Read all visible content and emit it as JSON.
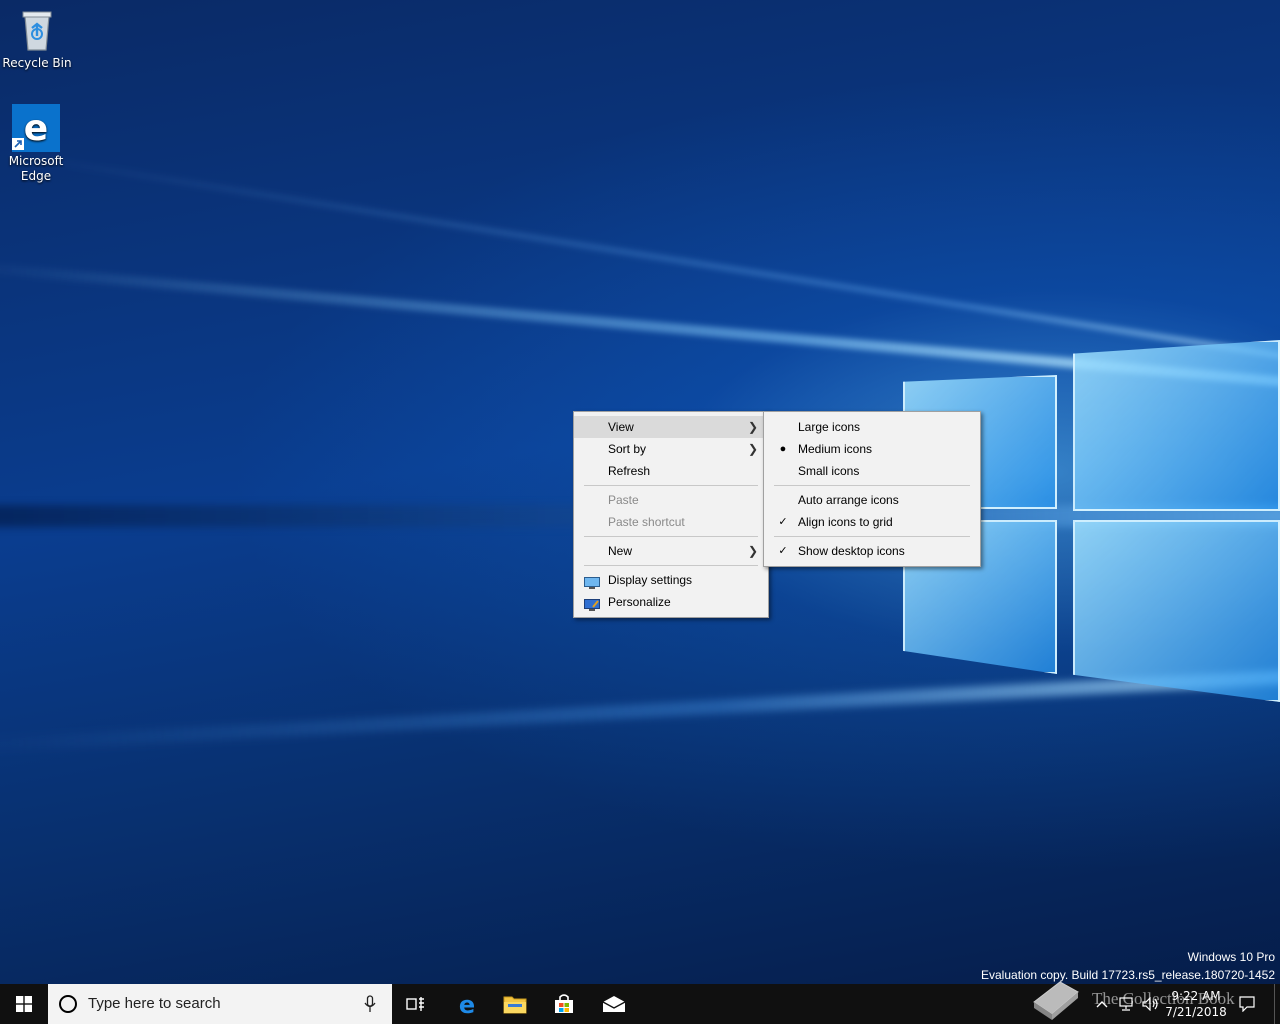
{
  "desktop_icons": [
    {
      "label": "Recycle Bin",
      "icon": "recycle-bin-icon"
    },
    {
      "label": "Microsoft Edge",
      "label_line1": "Microsoft",
      "label_line2": "Edge",
      "icon": "edge-icon"
    }
  ],
  "context_menu": {
    "items": [
      {
        "label": "View",
        "has_submenu": true,
        "active": true
      },
      {
        "label": "Sort by",
        "has_submenu": true
      },
      {
        "label": "Refresh"
      },
      {
        "label": "Paste",
        "disabled": true
      },
      {
        "label": "Paste shortcut",
        "disabled": true
      },
      {
        "label": "New",
        "has_submenu": true
      },
      {
        "label": "Display settings",
        "icon": "display-settings-icon"
      },
      {
        "label": "Personalize",
        "icon": "personalize-icon"
      }
    ]
  },
  "view_submenu": {
    "items": [
      {
        "label": "Large icons"
      },
      {
        "label": "Medium icons",
        "mark": "bullet"
      },
      {
        "label": "Small icons"
      },
      {
        "label": "Auto arrange icons"
      },
      {
        "label": "Align icons to grid",
        "mark": "check"
      },
      {
        "label": "Show desktop icons",
        "mark": "check"
      }
    ]
  },
  "watermark": {
    "edition": "Windows 10 Pro",
    "build": "Evaluation copy. Build 17723.rs5_release.180720-1452"
  },
  "taskbar": {
    "search_placeholder": "Type here to search",
    "pinned": [
      "task-view-icon",
      "edge-icon",
      "file-explorer-icon",
      "store-icon",
      "mail-icon"
    ],
    "time": "9:22 AM",
    "date": "7/21/2018"
  },
  "overlay_watermark": "The Collection Book",
  "colors": {
    "taskbar": "#101010",
    "menu_bg": "#f2f2f2",
    "accent": "#0078d7"
  }
}
